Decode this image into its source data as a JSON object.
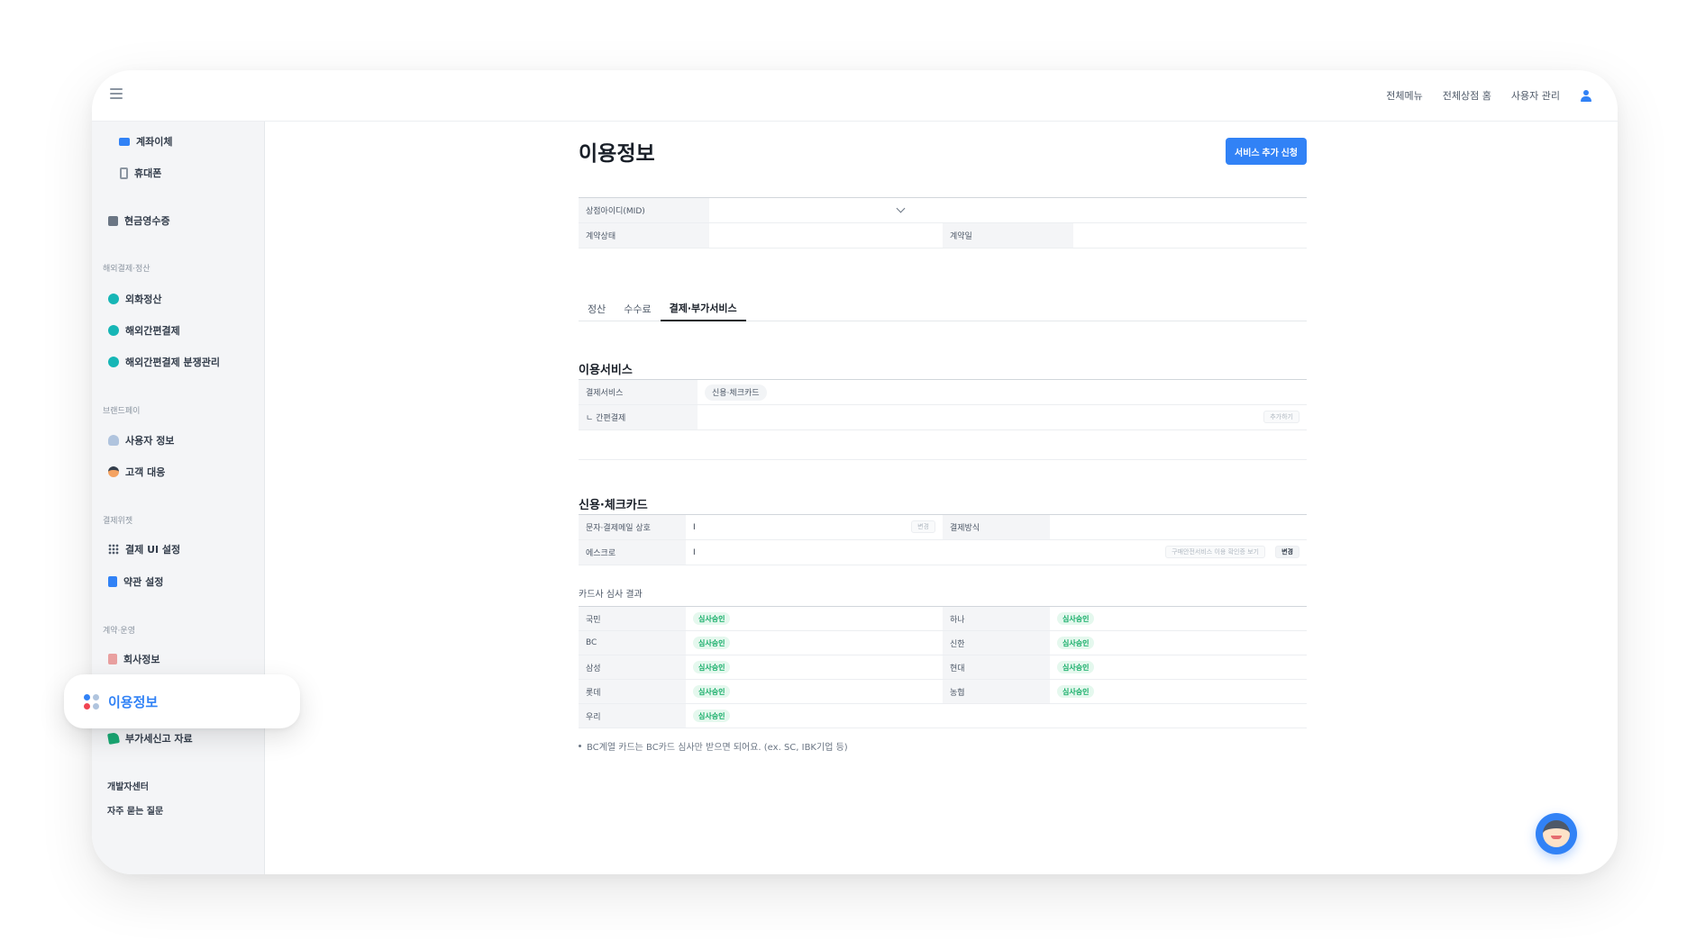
{
  "topbar": {
    "menu_icon": "hamburger-icon",
    "links": [
      "전체메뉴",
      "전체상점 홈",
      "사용자 관리"
    ],
    "user_icon": "user-icon"
  },
  "sidebar": {
    "items_top": [
      {
        "label": "계좌이체",
        "icon": "card-icon"
      },
      {
        "label": "휴대폰",
        "icon": "phone-icon"
      },
      {
        "label": "현금영수증",
        "icon": "receipt-icon"
      }
    ],
    "section_overseas": "해외결제·정산",
    "overseas_items": [
      "외화정산",
      "해외간편결제",
      "해외간편결제 분쟁관리"
    ],
    "section_brandpay": "브랜드페이",
    "brandpay_items": [
      "사용자 정보",
      "고객 대응"
    ],
    "section_widget": "결제위젯",
    "widget_items": [
      "결제 UI 설정",
      "약관 설정"
    ],
    "section_contract": "계약·운영",
    "contract_items": [
      "회사정보",
      "이용정보",
      "부가세신고 자료"
    ],
    "footer_links": [
      "개발자센터",
      "자주 묻는 질문"
    ]
  },
  "floating_active": {
    "label": "이용정보",
    "icon": "service-info-icon",
    "color": "#3182f6"
  },
  "page": {
    "title": "이용정보",
    "add_button": "서비스 추가 신청"
  },
  "info": {
    "mid_label": "상점아이디(MID)",
    "mid_value": "",
    "status_label": "계약상태",
    "status_value": "",
    "date_label": "계약일",
    "date_value": ""
  },
  "tabs": [
    "정산",
    "수수료",
    "결제·부가서비스"
  ],
  "active_tab": 2,
  "services": {
    "title": "이용서비스",
    "rows": [
      {
        "label": "결제서비스",
        "chip": "신용·체크카드"
      },
      {
        "label": "ㄴ 간편결제",
        "button": "추가하기"
      }
    ]
  },
  "card": {
    "title": "신용·체크카드",
    "row1": {
      "label": "문자·결제메일 상호",
      "value": "I",
      "button": "변경",
      "label2": "결제방식",
      "value2": ""
    },
    "row2": {
      "label": "에스크로",
      "value": "I",
      "link_button": "구매안전서비스 이용 확인증 보기",
      "button": "변경"
    },
    "review_title": "카드사 심사 결과",
    "reviews": [
      {
        "left": "국민",
        "left_status": "심사승인",
        "right": "하나",
        "right_status": "심사승인"
      },
      {
        "left": "BC",
        "left_status": "심사승인",
        "right": "신한",
        "right_status": "심사승인"
      },
      {
        "left": "삼성",
        "left_status": "심사승인",
        "right": "현대",
        "right_status": "심사승인"
      },
      {
        "left": "롯데",
        "left_status": "심사승인",
        "right": "농협",
        "right_status": "심사승인"
      },
      {
        "left": "우리",
        "left_status": "심사승인",
        "right": "",
        "right_status": ""
      }
    ],
    "note": "BC계열 카드는 BC카드 심사만 받으면 되어요. (ex. SC, IBK기업 등)"
  },
  "chat": {
    "icon": "chatbot-avatar-icon"
  },
  "colors": {
    "accent": "#3182f6",
    "approved": "#12ac66",
    "approved_bg": "#e5f8ee"
  }
}
